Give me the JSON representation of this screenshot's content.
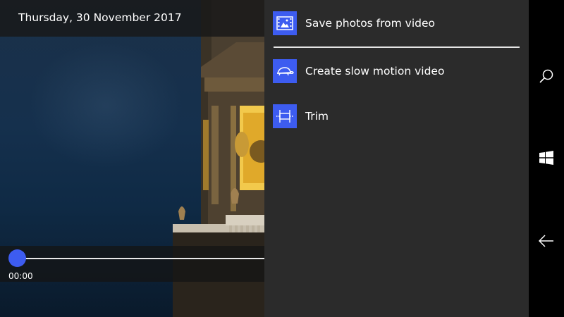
{
  "video": {
    "date": "Thursday, 30 November 2017",
    "current_time": "00:00",
    "progress": 0
  },
  "menu": {
    "items": [
      {
        "label": "Save photos from video",
        "icon": "film-photos-icon"
      },
      {
        "label": "Create slow motion video",
        "icon": "turtle-icon"
      },
      {
        "label": "Trim",
        "icon": "trim-icon"
      }
    ]
  },
  "navbar": {
    "buttons": [
      {
        "icon": "search-icon"
      },
      {
        "icon": "windows-icon"
      },
      {
        "icon": "back-icon"
      }
    ]
  },
  "colors": {
    "accent": "#3d5cf0",
    "menu_background": "#2b2b2b",
    "navbar_background": "#000000"
  }
}
